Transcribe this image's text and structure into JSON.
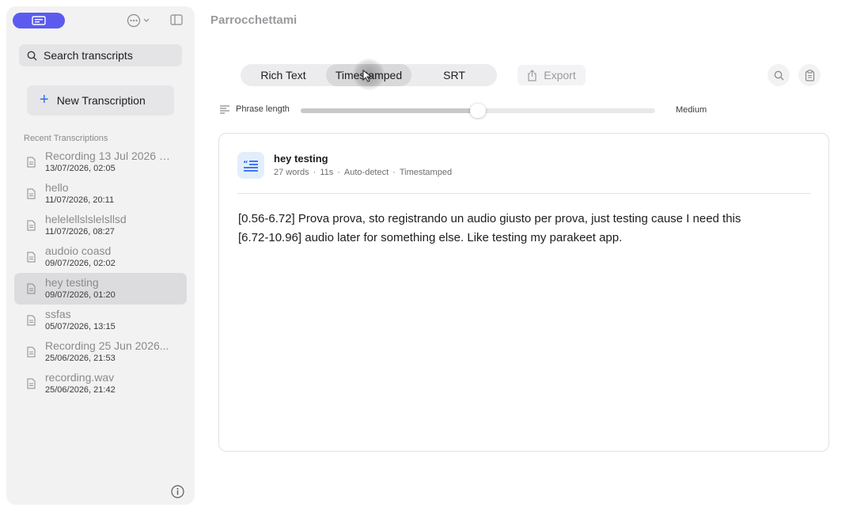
{
  "app": {
    "title": "Parrocchettami"
  },
  "sidebar": {
    "search_placeholder": "Search transcripts",
    "new_transcription_label": "New Transcription",
    "recent_label": "Recent Transcriptions",
    "items": [
      {
        "title": "Recording 13 Jul 2026 a...",
        "date": "13/07/2026, 02:05",
        "selected": false
      },
      {
        "title": "hello",
        "date": "11/07/2026, 20:11",
        "selected": false
      },
      {
        "title": "helelellslslelsllsd",
        "date": "11/07/2026, 08:27",
        "selected": false
      },
      {
        "title": "audoio coasd",
        "date": "09/07/2026, 02:02",
        "selected": false
      },
      {
        "title": "hey testing",
        "date": "09/07/2026, 01:20",
        "selected": true
      },
      {
        "title": "ssfas",
        "date": "05/07/2026, 13:15",
        "selected": false
      },
      {
        "title": "Recording 25 Jun 2026...",
        "date": "25/06/2026, 21:53",
        "selected": false
      },
      {
        "title": "recording.wav",
        "date": "25/06/2026, 21:42",
        "selected": false
      }
    ]
  },
  "toolbar": {
    "tabs": [
      "Rich Text",
      "Timestamped",
      "SRT"
    ],
    "active_tab": "Timestamped",
    "export_label": "Export"
  },
  "phrase": {
    "label": "Phrase length",
    "value_label": "Medium",
    "fraction": 0.5
  },
  "card": {
    "title": "hey testing",
    "meta": [
      "27 words",
      "11s",
      "Auto-detect",
      "Timestamped"
    ],
    "lines": [
      "[0.56-6.72] Prova prova, sto registrando un audio giusto per prova, just testing cause I need this",
      "[6.72-10.96] audio later for something else. Like testing my parakeet app."
    ]
  },
  "colors": {
    "accent": "#5b5bf0",
    "link": "#2d6ef2",
    "icon_bg": "#e3eefc"
  }
}
